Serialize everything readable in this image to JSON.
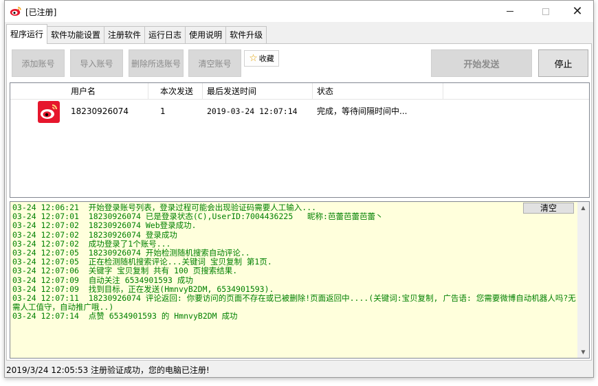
{
  "window": {
    "title": "[已注册]",
    "buttons": {
      "minimize": "minimize-icon",
      "maximize": "maximize-icon",
      "close": "close-icon"
    }
  },
  "tabs": [
    {
      "label": "程序运行",
      "active": true
    },
    {
      "label": "软件功能设置",
      "active": false
    },
    {
      "label": "注册软件",
      "active": false
    },
    {
      "label": "运行日志",
      "active": false
    },
    {
      "label": "使用说明",
      "active": false
    },
    {
      "label": "软件升级",
      "active": false
    }
  ],
  "toolbar": {
    "add_account": "添加账号",
    "import_account": "导入账号",
    "delete_selected": "删除所选账号",
    "clear_accounts": "清空账号",
    "favorite": "收藏",
    "start_send": "开始发送",
    "stop": "停止"
  },
  "account_list": {
    "columns": [
      "用户名",
      "本次发送",
      "最后发送时间",
      "状态"
    ],
    "rows": [
      {
        "icon": "weibo-icon",
        "username": "18230926074",
        "sent": "1",
        "last_time": "2019-03-24 12:07:14",
        "status": "完成，等待间隔时间中..."
      }
    ]
  },
  "log": {
    "clear_label": "清空",
    "lines": [
      "03-24 12:06:21  开始登录账号列表，登录过程可能会出现验证码需要人工输入...",
      "03-24 12:07:01  18230926074 已是登录状态(C),UserID:7004436225   昵称:芭蕾芭蕾芭蕾丶",
      "03-24 12:07:02  18230926074 Web登录成功.",
      "03-24 12:07:02  18230926074 登录成功",
      "03-24 12:07:02  成功登录了1个账号...",
      "03-24 12:07:05  18230926074 开始检测随机搜索自动评论..",
      "03-24 12:07:05  正在检测随机搜索评论...关键词 宝贝复制 第1页.",
      "03-24 12:07:06  关键字 宝贝复制 共有 100 页搜索结果.",
      "03-24 12:07:09  自动关注 6534901593 成功",
      "03-24 12:07:09  找到目标，正在发送(HmnvyB2DM, 6534901593).",
      "03-24 12:07:11  18230926074 评论返回: 你要访问的页面不存在或已被删除!页面返回中....(关键词:宝贝复制, 广告语: 您需要微博自动机器人吗?无需人工值守，自动推广哦..)",
      "03-24 12:07:14  点赞 6534901593 的 HmnvyB2DM 成功"
    ]
  },
  "status_bar": "2019/3/24 12:05:53  注册验证成功，您的电脑已注册!"
}
